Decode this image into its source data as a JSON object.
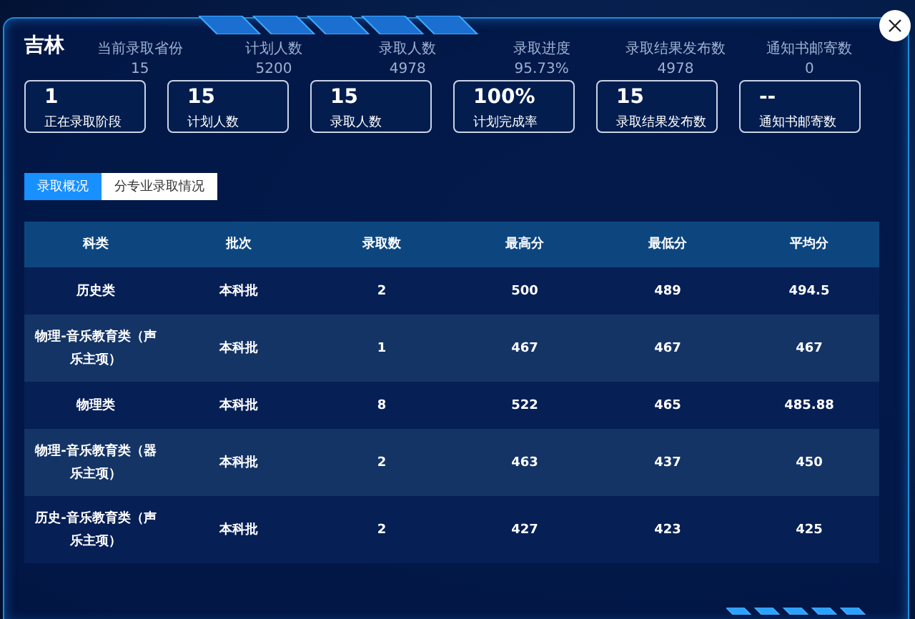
{
  "background_stats": [
    {
      "label": "当前录取省份",
      "value": "15"
    },
    {
      "label": "计划人数",
      "value": "5200"
    },
    {
      "label": "录取人数",
      "value": "4978"
    },
    {
      "label": "录取进度",
      "value": "95.73%"
    },
    {
      "label": "录取结果发布数",
      "value": "4978"
    },
    {
      "label": "通知书邮寄数",
      "value": "0"
    }
  ],
  "dialog": {
    "title": "吉林"
  },
  "stats": [
    {
      "value": "1",
      "label": "正在录取阶段"
    },
    {
      "value": "15",
      "label": "计划人数"
    },
    {
      "value": "15",
      "label": "录取人数"
    },
    {
      "value": "100%",
      "label": "计划完成率"
    },
    {
      "value": "15",
      "label": "录取结果发布数"
    },
    {
      "value": "--",
      "label": "通知书邮寄数"
    }
  ],
  "tabs": [
    {
      "label": "录取概况",
      "selected": true
    },
    {
      "label": "分专业录取情况",
      "selected": false
    }
  ],
  "table": {
    "columns": [
      "科类",
      "批次",
      "录取数",
      "最高分",
      "最低分",
      "平均分"
    ],
    "rows": [
      [
        "历史类",
        "本科批",
        "2",
        "500",
        "489",
        "494.5"
      ],
      [
        "物理-音乐教育类（声乐主项）",
        "本科批",
        "1",
        "467",
        "467",
        "467"
      ],
      [
        "物理类",
        "本科批",
        "8",
        "522",
        "465",
        "485.88"
      ],
      [
        "物理-音乐教育类（器乐主项）",
        "本科批",
        "2",
        "463",
        "437",
        "450"
      ],
      [
        "历史-音乐教育类（声乐主项）",
        "本科批",
        "2",
        "427",
        "423",
        "425"
      ]
    ]
  }
}
